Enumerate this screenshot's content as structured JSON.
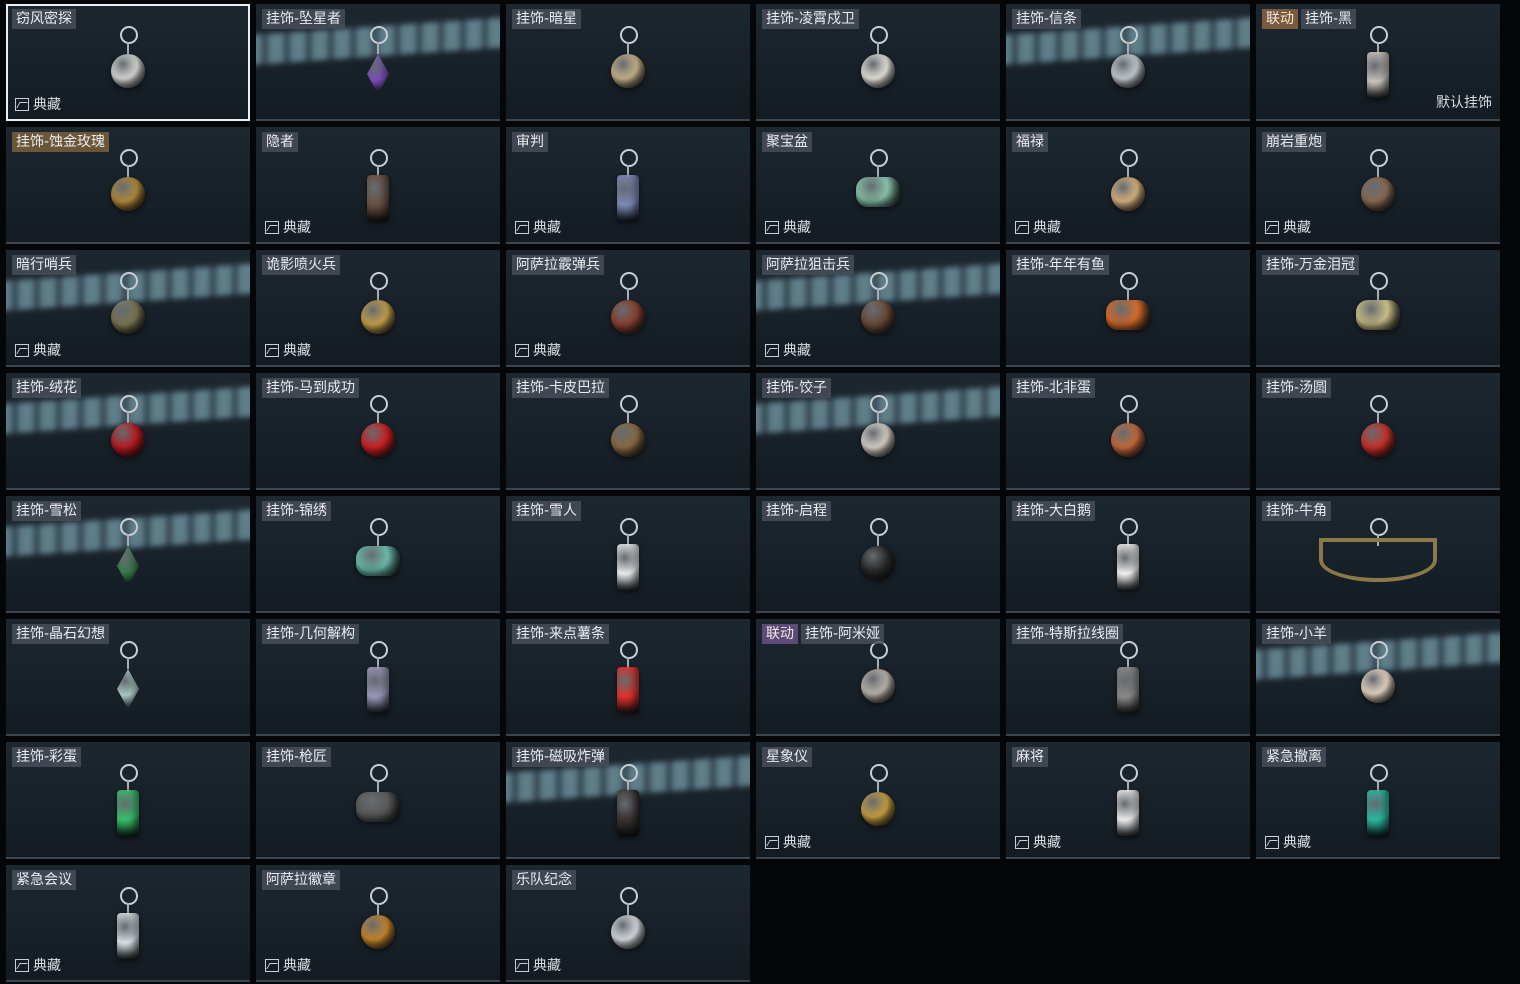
{
  "tier_label": "典藏",
  "default_label": "默认挂饰",
  "items": [
    {
      "name": "窃风密探",
      "tier": true,
      "selected": true,
      "color": "#d9dad6"
    },
    {
      "name": "挂饰-坠星者",
      "streak": true,
      "color": "#7a4bb8",
      "shape": "diamond"
    },
    {
      "name": "挂饰-暗星",
      "color": "#c9b48a"
    },
    {
      "name": "挂饰-凌霄戍卫",
      "color": "#e8e4dd"
    },
    {
      "name": "挂饰-信条",
      "streak": true,
      "color": "#c6ccd2"
    },
    {
      "name": "挂饰-黑",
      "collab": "联动",
      "default": true,
      "color": "#c9c3bd",
      "shape": "tall"
    },
    {
      "name": "挂饰-蚀金玫瑰",
      "gold": true,
      "color": "#b28a3a"
    },
    {
      "name": "隐者",
      "tier": true,
      "color": "#6a5040",
      "shape": "tall"
    },
    {
      "name": "审判",
      "tier": true,
      "color": "#7d88b8",
      "shape": "tall"
    },
    {
      "name": "聚宝盆",
      "tier": true,
      "color": "#86c0a6",
      "shape": "wide"
    },
    {
      "name": "福禄",
      "tier": true,
      "color": "#d9b380"
    },
    {
      "name": "崩岩重炮",
      "tier": true,
      "color": "#8a6a52"
    },
    {
      "name": "暗行哨兵",
      "tier": true,
      "streak": true,
      "color": "#7a7450"
    },
    {
      "name": "诡影喷火兵",
      "tier": true,
      "color": "#c6a04a"
    },
    {
      "name": "阿萨拉霰弹兵",
      "tier": true,
      "color": "#8a4030"
    },
    {
      "name": "阿萨拉狙击兵",
      "tier": true,
      "streak": true,
      "color": "#6a4a36"
    },
    {
      "name": "挂饰-年年有鱼",
      "color": "#d46a2c",
      "shape": "wide"
    },
    {
      "name": "挂饰-万金泪冠",
      "color": "#c8bc86",
      "shape": "wide"
    },
    {
      "name": "挂饰-绒花",
      "streak": true,
      "color": "#b81a20"
    },
    {
      "name": "挂饰-马到成功",
      "color": "#d02020"
    },
    {
      "name": "挂饰-卡皮巴拉",
      "color": "#8a6a40"
    },
    {
      "name": "挂饰-饺子",
      "streak": true,
      "color": "#d8d2c6"
    },
    {
      "name": "挂饰-北非蛋",
      "color": "#c66a3a"
    },
    {
      "name": "挂饰-汤圆",
      "color": "#c83028"
    },
    {
      "name": "挂饰-雪松",
      "streak": true,
      "color": "#3a7a4a",
      "shape": "diamond"
    },
    {
      "name": "挂饰-锦绣",
      "color": "#6ab8a8",
      "shape": "wide"
    },
    {
      "name": "挂饰-雪人",
      "color": "#e8eaea",
      "shape": "tall"
    },
    {
      "name": "挂饰-启程",
      "color": "#2a2a2a"
    },
    {
      "name": "挂饰-大白鹅",
      "color": "#f0f0ee",
      "shape": "tall"
    },
    {
      "name": "挂饰-牛角",
      "color": "#8a7a4a",
      "shape": "horn"
    },
    {
      "name": "挂饰-晶石幻想",
      "color": "#a8c8c4",
      "shape": "diamond"
    },
    {
      "name": "挂饰-几何解构",
      "color": "#9a98b8",
      "shape": "tall"
    },
    {
      "name": "挂饰-来点薯条",
      "color": "#e0302a",
      "shape": "tall"
    },
    {
      "name": "挂饰-阿米娅",
      "collab": "联动",
      "collab_violet": true,
      "color": "#bdb6ae"
    },
    {
      "name": "挂饰-特斯拉线圈",
      "color": "#8c8a88",
      "shape": "tall"
    },
    {
      "name": "挂饰-小羊",
      "streak": true,
      "color": "#e8d6c2"
    },
    {
      "name": "挂饰-彩蛋",
      "color": "#38c06a",
      "shape": "tall"
    },
    {
      "name": "挂饰-枪匠",
      "color": "#5a5a5a",
      "shape": "wide"
    },
    {
      "name": "挂饰-磁吸炸弹",
      "streak": true,
      "color": "#3a3230",
      "shape": "tall"
    },
    {
      "name": "星象仪",
      "tier": true,
      "color": "#c8a040"
    },
    {
      "name": "麻将",
      "tier": true,
      "color": "#ececec",
      "shape": "tall"
    },
    {
      "name": "紧急撤离",
      "tier": true,
      "color": "#2ab8a0",
      "shape": "tall"
    },
    {
      "name": "紧急会议",
      "tier": true,
      "color": "#d8e0e2",
      "shape": "tall"
    },
    {
      "name": "阿萨拉徽章",
      "tier": true,
      "color": "#c8862a"
    },
    {
      "name": "乐队纪念",
      "tier": true,
      "color": "#d8dce0"
    }
  ]
}
